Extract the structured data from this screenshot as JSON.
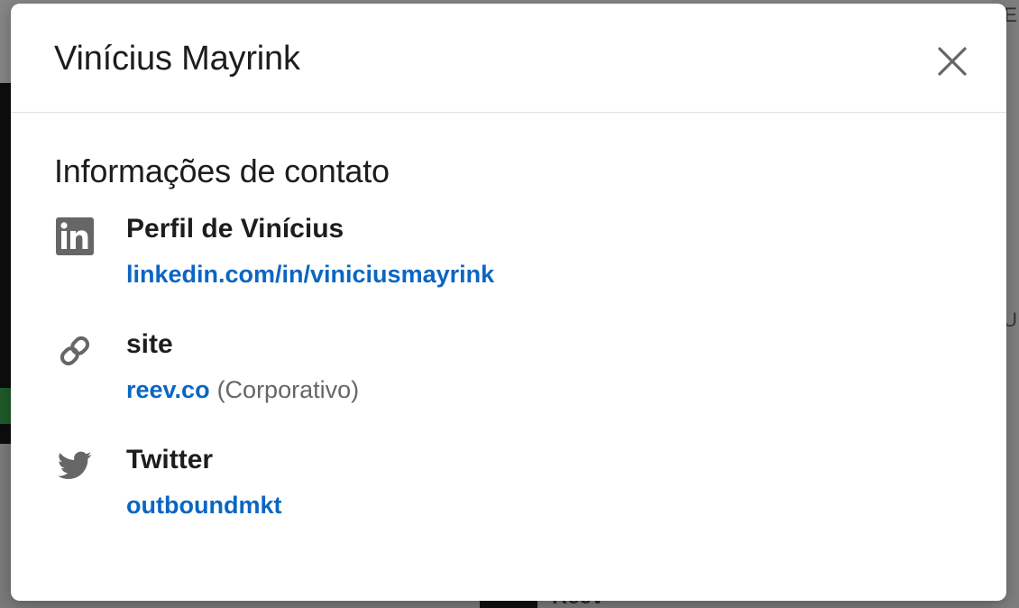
{
  "background": {
    "bottom_text": "Reev",
    "right_glyph_top": "E",
    "right_glyph_mid": "U"
  },
  "modal": {
    "title": "Vinícius Mayrink",
    "close_icon": "close-icon"
  },
  "contact_info": {
    "section_title": "Informações de contato",
    "items": [
      {
        "icon": "linkedin-icon",
        "label": "Perfil de Vinícius",
        "value": "linkedin.com/in/viniciusmayrink",
        "note": ""
      },
      {
        "icon": "link-icon",
        "label": "site",
        "value": "reev.co",
        "note": "(Corporativo)"
      },
      {
        "icon": "twitter-icon",
        "label": "Twitter",
        "value": "outboundmkt",
        "note": ""
      }
    ]
  },
  "colors": {
    "link": "#0a66c2",
    "text": "#1d1d1d",
    "muted": "#666666",
    "icon": "#666666"
  }
}
